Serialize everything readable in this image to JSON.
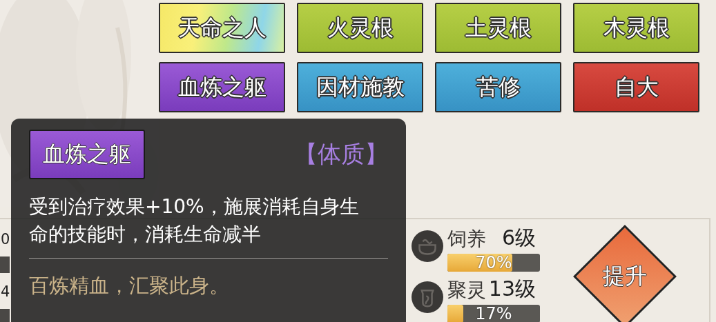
{
  "traits": [
    {
      "label": "天命之人",
      "kind": "rainbow"
    },
    {
      "label": "火灵根",
      "kind": "green"
    },
    {
      "label": "土灵根",
      "kind": "green"
    },
    {
      "label": "木灵根",
      "kind": "green"
    },
    {
      "label": "血炼之躯",
      "kind": "purple"
    },
    {
      "label": "因材施教",
      "kind": "blue"
    },
    {
      "label": "苦修",
      "kind": "blue"
    },
    {
      "label": "自大",
      "kind": "red"
    }
  ],
  "skills_left": [
    {
      "rank": "0"
    },
    {
      "rank": "4"
    }
  ],
  "skills": [
    {
      "name": "饲养",
      "rank": "6级",
      "progress": "70%",
      "level": 0.7
    },
    {
      "name": "聚灵",
      "rank": "13级",
      "progress": "17%",
      "level": 0.17
    }
  ],
  "upgrade_button": "提升",
  "tooltip": {
    "badge": "血炼之躯",
    "category": "【体质】",
    "description": "受到治疗效果+10%，施展消耗自身生命的技能时，消耗生命减半",
    "flavor": "百炼精血，汇聚此身。"
  }
}
